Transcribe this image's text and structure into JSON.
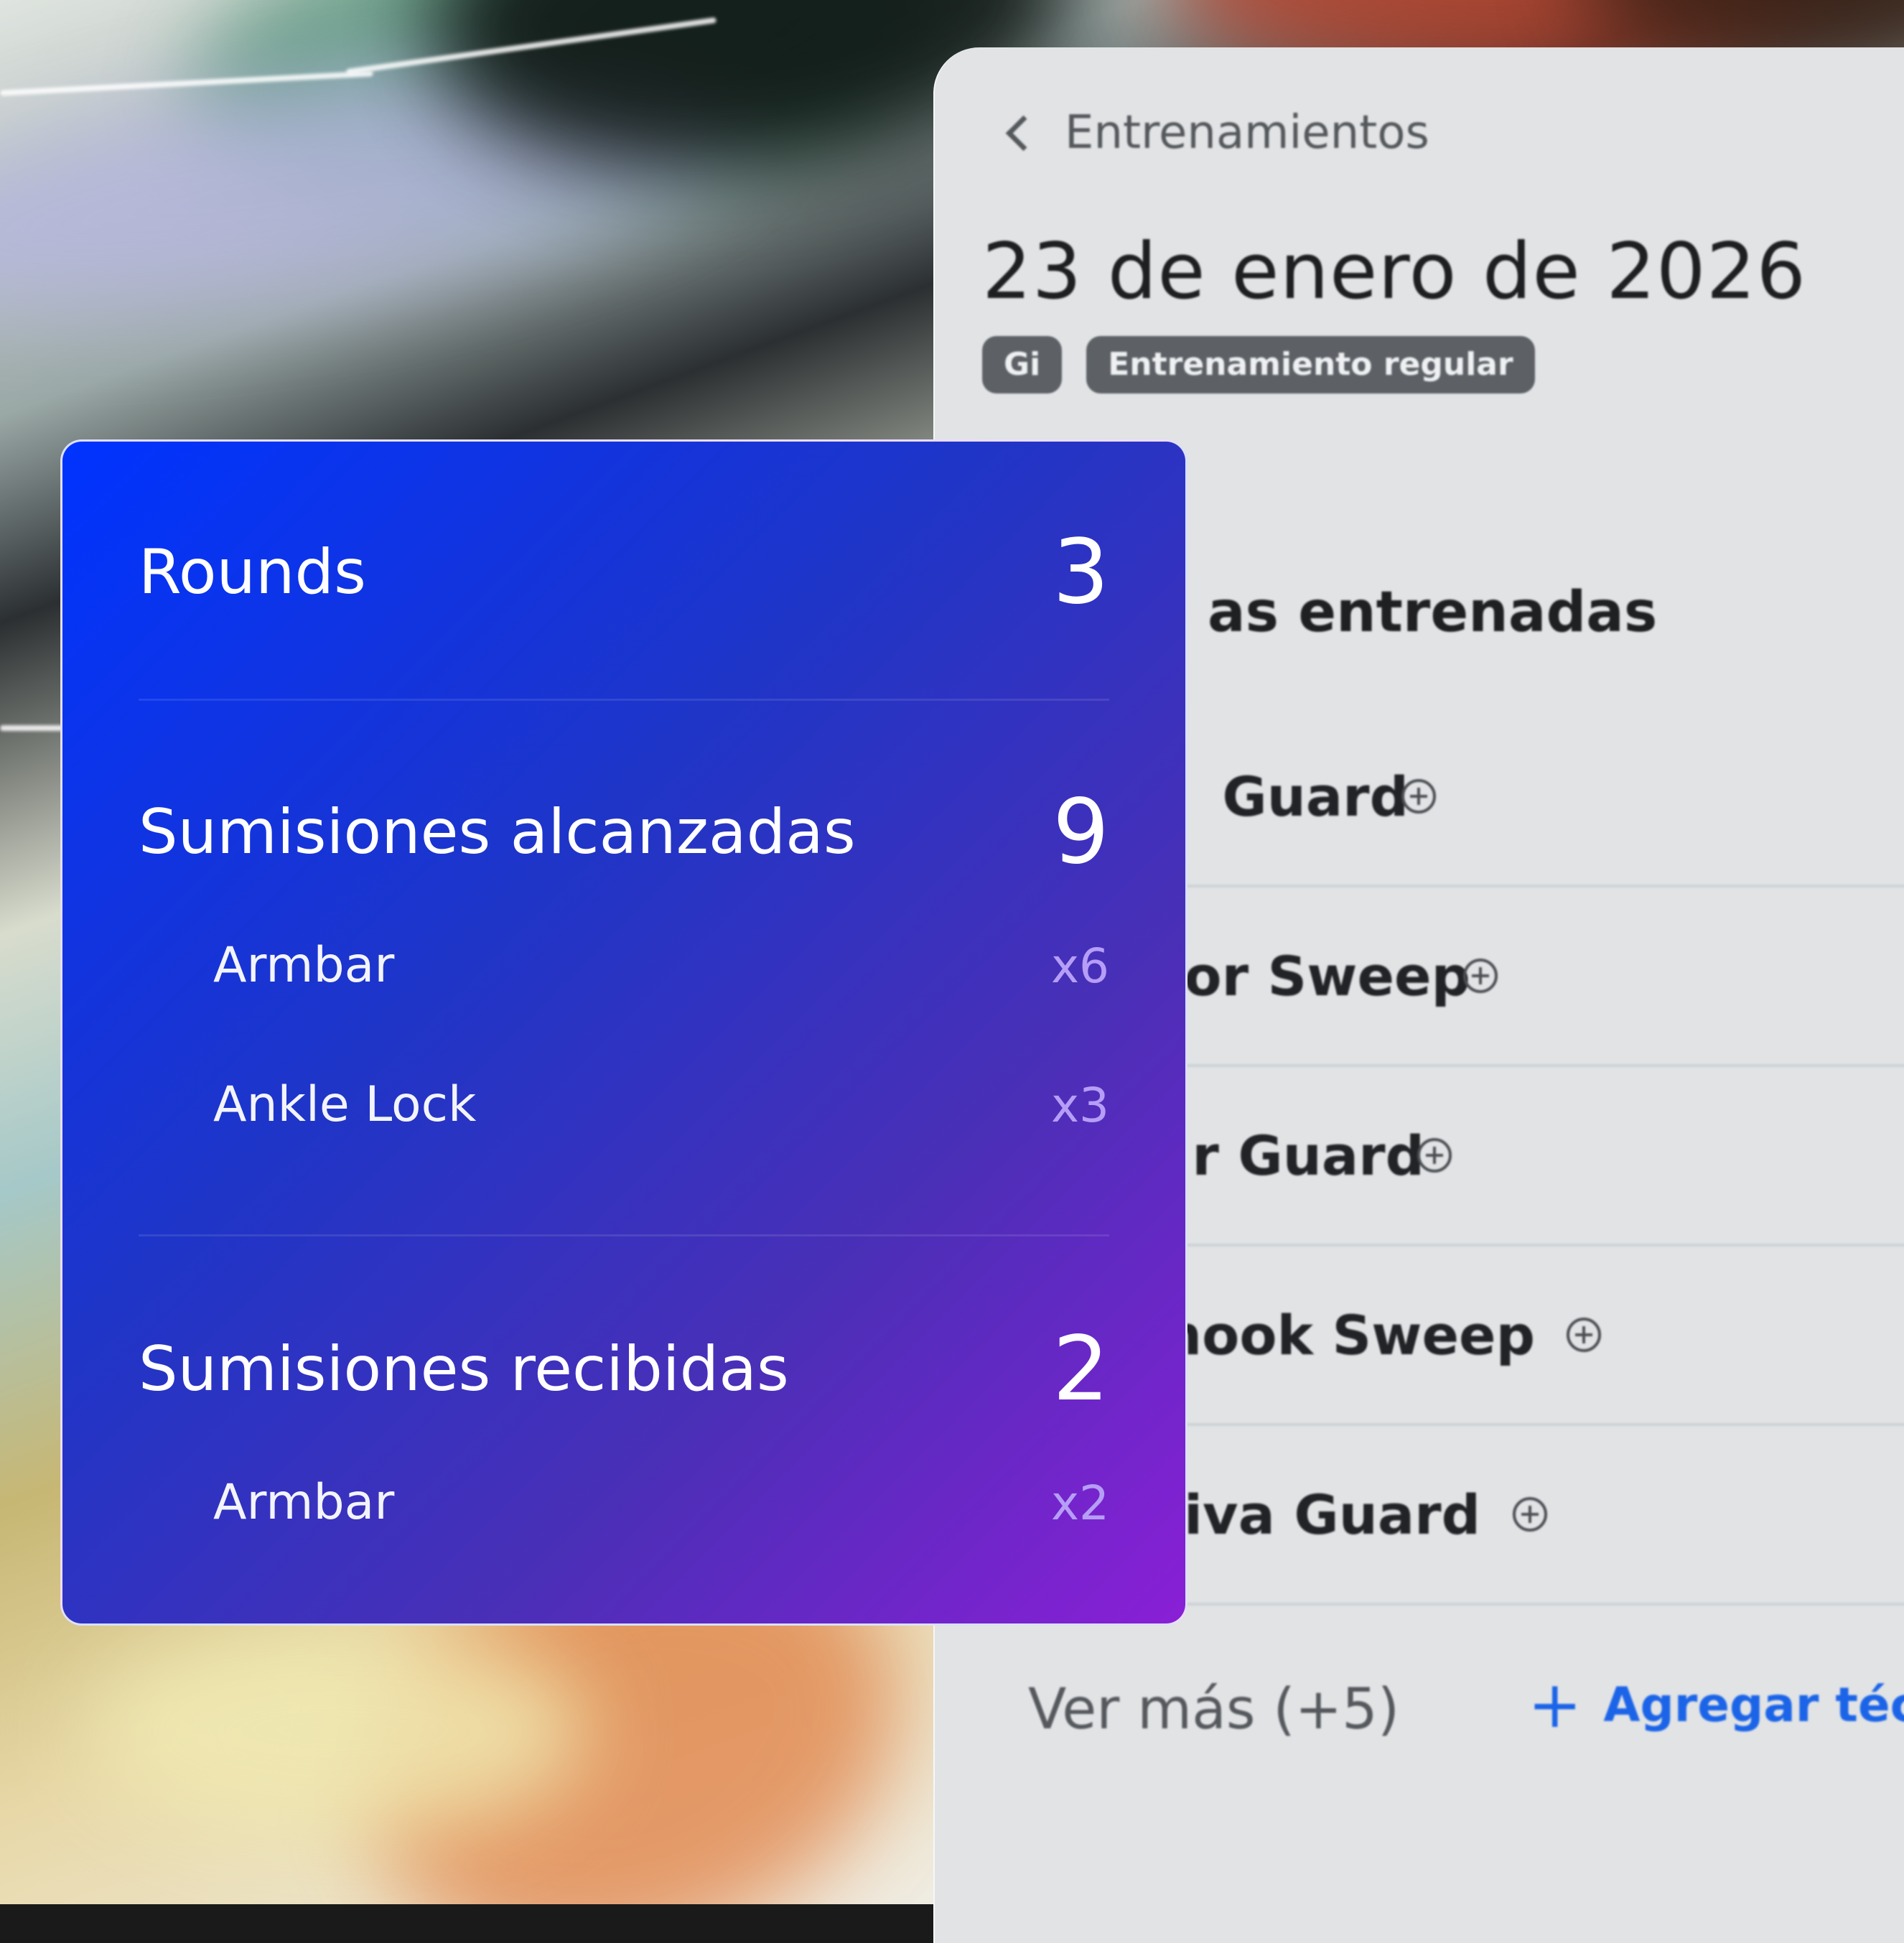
{
  "app_panel": {
    "back_label": "Entrenamientos",
    "date_title": "23 de enero de 2026",
    "tags": [
      "Gi",
      "Entrenamiento regular"
    ],
    "section_title": "as entrenadas",
    "techniques": [
      "Guard",
      "or Sweep",
      "r Guard",
      "hook Sweep",
      "Riva Guard"
    ],
    "see_more": "Ver más (+5)",
    "add_technique": "Agregar técnic",
    "accent_color": "#1b64e8"
  },
  "stats_card": {
    "rounds": {
      "label": "Rounds",
      "value": "3"
    },
    "submissions_achieved": {
      "label": "Sumisiones alcanzadas",
      "value": "9",
      "items": [
        {
          "name": "Armbar",
          "count": "x6"
        },
        {
          "name": "Ankle Lock",
          "count": "x3"
        }
      ]
    },
    "submissions_received": {
      "label": "Sumisiones recibidas",
      "value": "2",
      "items": [
        {
          "name": "Armbar",
          "count": "x2"
        }
      ]
    },
    "gradient_colors": [
      "#0033ff",
      "#8a1fd6"
    ]
  }
}
